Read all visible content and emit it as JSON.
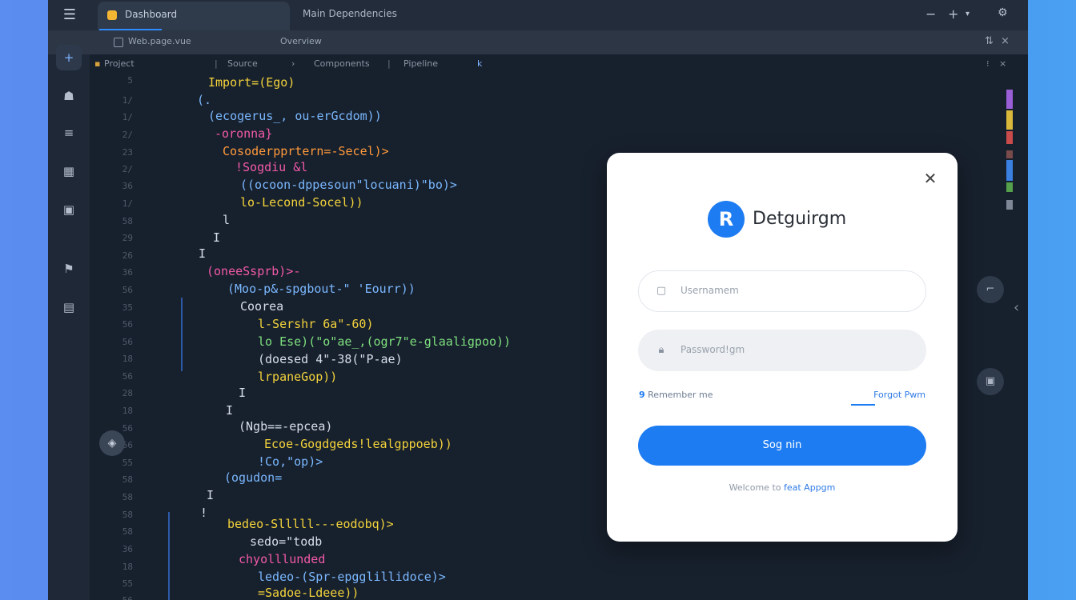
{
  "titlebar": {
    "tab_active_label": "Dashboard",
    "tab_inactive_label": "Main  Dependencies",
    "menu_icon": "hamburger-icon"
  },
  "subbar": {
    "file_label": "Web.page.vue",
    "section_label": "Overview"
  },
  "breadcrumb": [
    "Project",
    "Source",
    "Components",
    "Pipeline"
  ],
  "line_numbers": [
    "5",
    "1/",
    "1/",
    "2/",
    "23",
    "2/",
    "36",
    "1/",
    "58",
    "29",
    "26",
    "36",
    "56",
    "35",
    "56",
    "56",
    "18",
    "56",
    "28",
    "18",
    "56",
    "56",
    "55",
    "58",
    "58",
    "58",
    "58",
    "36",
    "18",
    "55",
    "56",
    "55"
  ],
  "code_lines": [
    "Import=(Ego)",
    "(.",
    "(ecogerus_, ou-erGcdom))",
    "-oronna}",
    "Cosoderpprtern=-Secel)>",
    "!Sogdiu &l",
    "((ocoon-dppesoun\"locuani)\"bo)>",
    "lo-Lecond-Socel))",
    "l",
    "I",
    "I",
    "(oneeSsprb)>-",
    "(Moo-p&-spgbout-\" 'Eourr))",
    "Coorea",
    "l-Sershr 6a\"-60)",
    "lo Ese)(\"o\"ae_,(ogr7\"e-glaaligpoo))",
    "(doesed 4\"-38(\"P-ae)",
    "lrpaneGop))",
    "I",
    "I",
    "(Ngb==-epcea)",
    "Ecoe-Gogdgeds!lealgppoeb))",
    "!Co,\"op)>",
    "(ogudon=",
    "I",
    "!",
    "bedeo-Slllll---eodobq)>",
    "sedo=\"todb",
    "chyolllunded",
    "ledeo-(Spr-epgglillidoce)>",
    "=Sadoe-Ldeee))"
  ],
  "dialog": {
    "brand": "Detguirgm",
    "logo_letter": "R",
    "username_placeholder": "Usernamem",
    "password_placeholder": "Password!gm",
    "remember_num": "9",
    "remember_text": "Remember me",
    "forgot_text": "Forgot Pwm",
    "signin_label": "Sog nin",
    "footer_text": "Welcome to",
    "footer_link": "feat Appgm"
  },
  "colors": {
    "accent": "#1e7cf2",
    "editor_bg": "#17202d",
    "code_yellow": "#f3d33b",
    "code_blue": "#7ab8ff",
    "code_pink": "#f25aa8",
    "code_green": "#7ee07e",
    "code_orange": "#ff9a3b"
  }
}
